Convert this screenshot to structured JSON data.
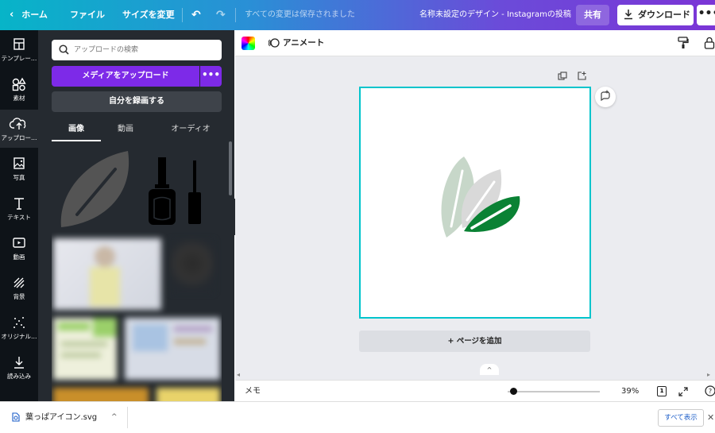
{
  "topbar": {
    "home": "ホーム",
    "file": "ファイル",
    "resize": "サイズを変更",
    "saved_status": "すべての変更は保存されました",
    "doc_title": "名称未設定のデザイン - Instagramの投稿",
    "share": "共有",
    "download": "ダウンロード",
    "more": "•••"
  },
  "rail": [
    {
      "label": "テンプレー…",
      "icon": "template-icon"
    },
    {
      "label": "素材",
      "icon": "elements-icon"
    },
    {
      "label": "アップロー…",
      "icon": "upload-icon",
      "active": true
    },
    {
      "label": "写真",
      "icon": "photo-icon"
    },
    {
      "label": "テキスト",
      "icon": "text-icon"
    },
    {
      "label": "動画",
      "icon": "video-icon"
    },
    {
      "label": "背景",
      "icon": "background-icon"
    },
    {
      "label": "オリジナル…",
      "icon": "original-icon"
    },
    {
      "label": "読み込み",
      "icon": "import-icon"
    }
  ],
  "panel": {
    "search_placeholder": "アップロードの検索",
    "upload_label": "メディアをアップロード",
    "upload_more": "•••",
    "record_label": "自分を録画する",
    "tabs": [
      "画像",
      "動画",
      "オーディオ"
    ]
  },
  "editor": {
    "animate_label": "アニメート",
    "add_page": "+ ページを追加"
  },
  "footer": {
    "memo": "メモ",
    "zoom": "39%",
    "zoom_level": 0.39,
    "page_count": "1"
  },
  "downloads": {
    "filename": "葉っぱアイコン.svg",
    "show_all": "すべて表示"
  },
  "colors": {
    "accent": "#7d2ae8",
    "selection": "#00c4cc",
    "leaf_dark": "#0a8234",
    "leaf_gray": "#d9d9d9",
    "leaf_sage": "#c7d7c9"
  }
}
